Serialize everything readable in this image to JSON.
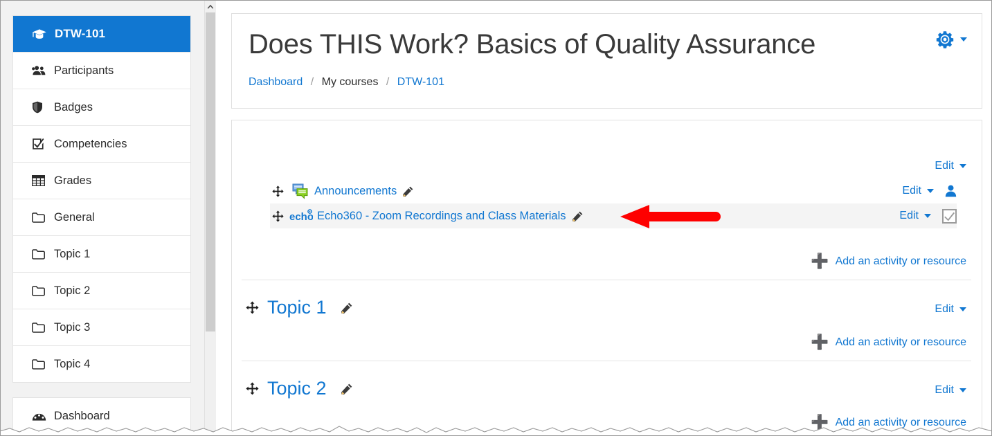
{
  "sidebar": {
    "course_badge": {
      "label": "DTW-101",
      "icon": "graduation-cap-icon",
      "background": "#1177d1"
    },
    "items": [
      {
        "label": "Participants",
        "icon": "users-icon"
      },
      {
        "label": "Badges",
        "icon": "shield-icon"
      },
      {
        "label": "Competencies",
        "icon": "check-square-icon"
      },
      {
        "label": "Grades",
        "icon": "table-grid-icon"
      },
      {
        "label": "General",
        "icon": "folder-icon"
      },
      {
        "label": "Topic 1",
        "icon": "folder-icon"
      },
      {
        "label": "Topic 2",
        "icon": "folder-icon"
      },
      {
        "label": "Topic 3",
        "icon": "folder-icon"
      },
      {
        "label": "Topic 4",
        "icon": "folder-icon"
      }
    ],
    "secondary_items": [
      {
        "label": "Dashboard",
        "icon": "dashboard-icon"
      }
    ]
  },
  "header": {
    "title": "Does THIS Work? Basics of Quality Assurance",
    "breadcrumb": [
      {
        "label": "Dashboard",
        "link": true
      },
      {
        "label": "My courses",
        "link": false
      },
      {
        "label": "DTW-101",
        "link": true
      }
    ],
    "breadcrumb_separator": "/",
    "settings_menu": {
      "icon": "gear-icon",
      "caret": "chevron-down-icon"
    }
  },
  "course_content": {
    "general_section": {
      "section_edit_label": "Edit",
      "activities": [
        {
          "name": "Announcements",
          "icon": "forum-icon",
          "edit_label": "Edit",
          "status_icon": "user-icon",
          "highlighted": false
        },
        {
          "name": "Echo360 - Zoom Recordings and Class Materials",
          "icon": "echo360-logo-icon",
          "edit_label": "Edit",
          "status_icon": "checkbox-checked-icon",
          "highlighted": true
        }
      ],
      "add_label": "Add an activity or resource"
    },
    "topics": [
      {
        "title": "Topic 1",
        "edit_label": "Edit",
        "add_label": "Add an activity or resource"
      },
      {
        "title": "Topic 2",
        "edit_label": "Edit",
        "add_label": "Add an activity or resource"
      }
    ]
  },
  "annotation": {
    "type": "arrow",
    "direction": "left",
    "color": "#fe0000",
    "points_at": "Echo360 - Zoom Recordings and Class Materials"
  },
  "colors": {
    "accent": "#1177d1",
    "page_bg": "#ffffff",
    "drawer_bg": "#f2f2f2",
    "highlight_row": "#f4f4f4",
    "text": "#2b2b2b",
    "annotation_red": "#fe0000"
  }
}
